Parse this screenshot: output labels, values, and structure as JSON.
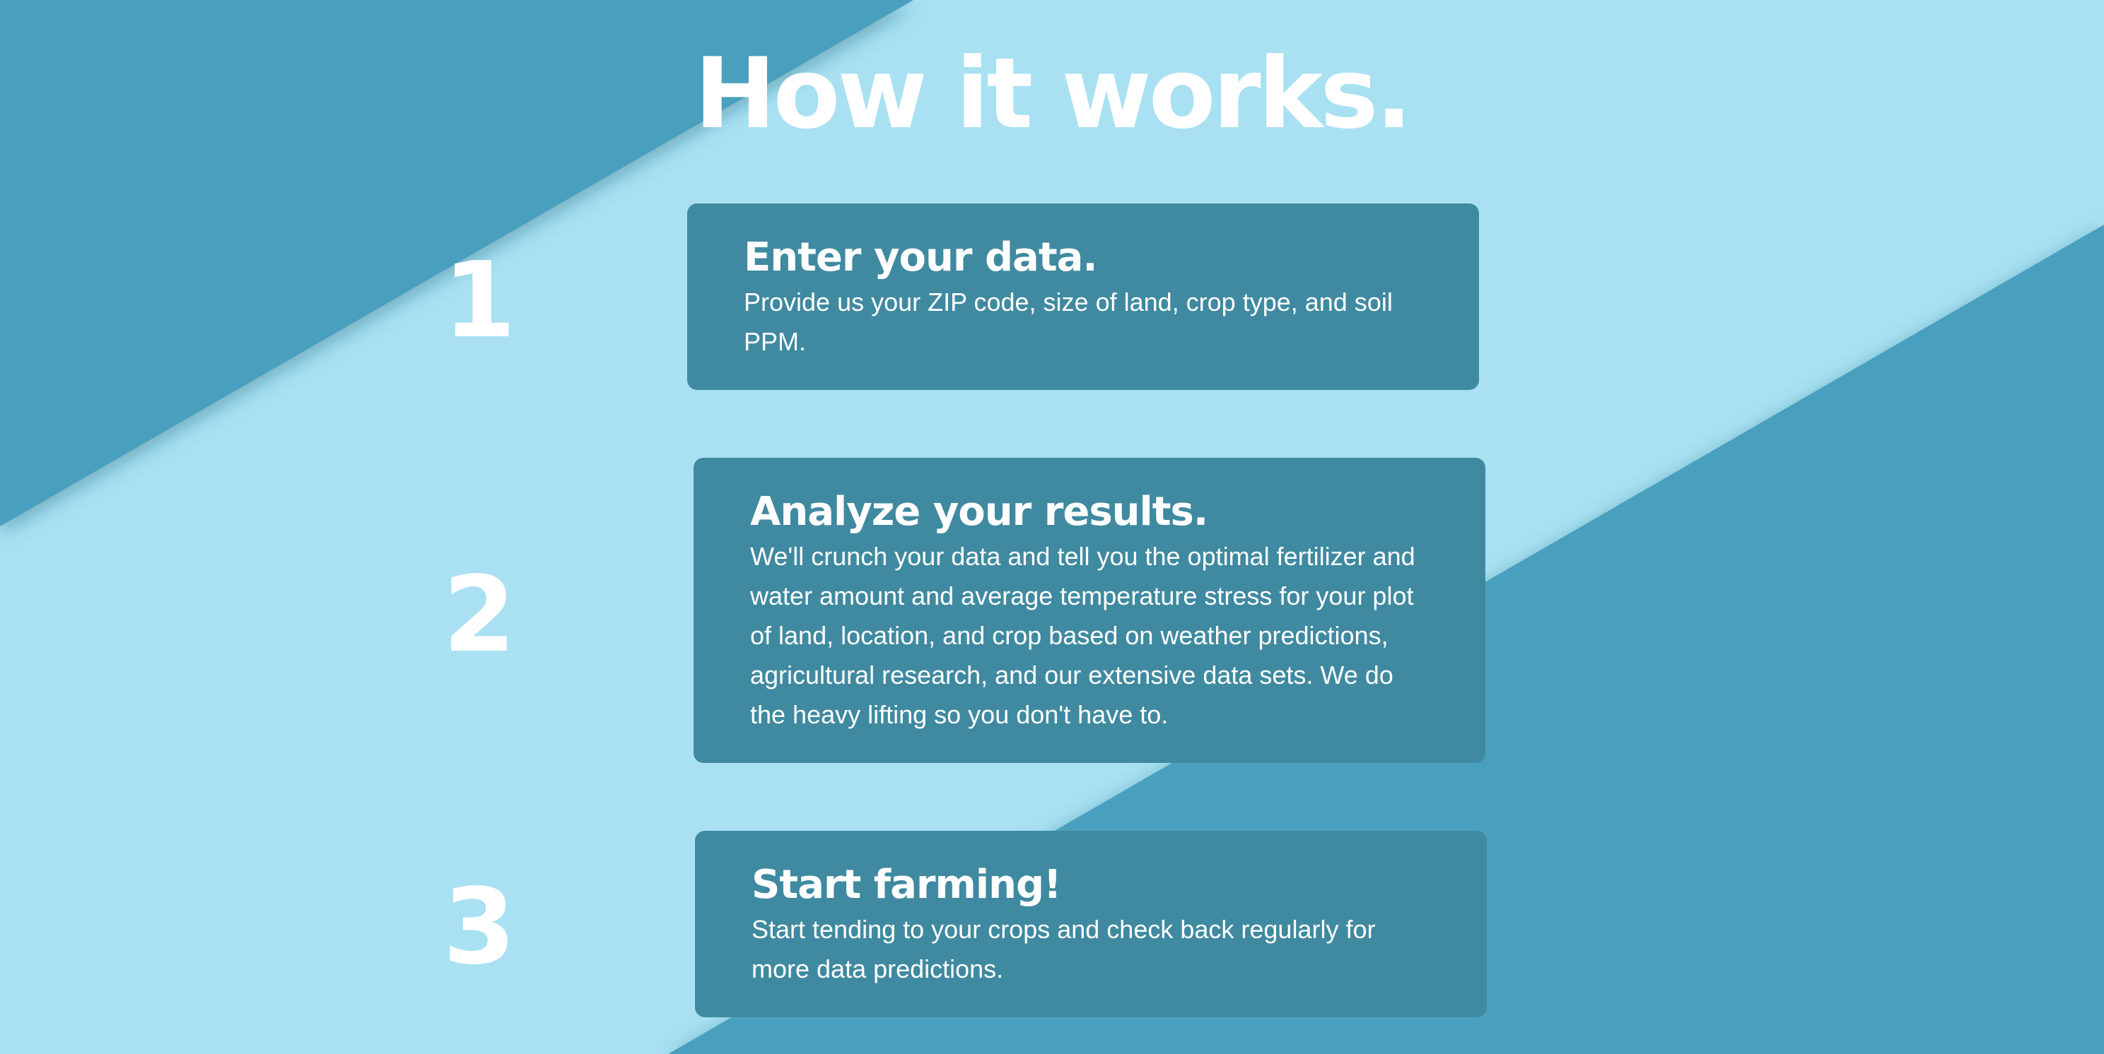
{
  "page": {
    "title": "How it works."
  },
  "colors": {
    "background_light": "#a9e1f2",
    "background_dark": "#4a9fbe",
    "card": "#3f8aa0",
    "text": "#ffffff"
  },
  "steps": [
    {
      "number": "1",
      "title": "Enter your data.",
      "description": "Provide us your ZIP code, size of land, crop type, and soil PPM."
    },
    {
      "number": "2",
      "title": "Analyze your results.",
      "description": "We'll crunch your data and tell you the optimal fertilizer and water amount and average temperature stress for your plot of land, location, and crop based on weather predictions, agricultural research, and our extensive data sets. We do the heavy lifting so you don't have to."
    },
    {
      "number": "3",
      "title": "Start farming!",
      "description": "Start tending to your crops and check back regularly for more data predictions."
    }
  ]
}
